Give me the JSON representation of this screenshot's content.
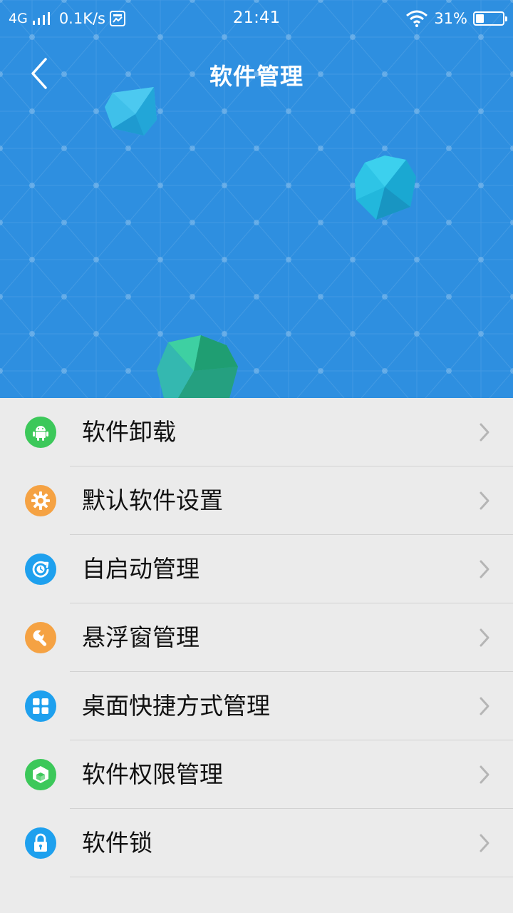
{
  "status_bar": {
    "network": "4G",
    "speed": "0.1K/s",
    "time": "21:41",
    "battery": "31%",
    "battery_level": 0.31
  },
  "header": {
    "title": "软件管理",
    "background_color": "#2e8fe0"
  },
  "menu": {
    "items": [
      {
        "label": "软件卸载",
        "icon": "android-icon",
        "color": "#3cc85a"
      },
      {
        "label": "默认软件设置",
        "icon": "gear-icon",
        "color": "#f5a243"
      },
      {
        "label": "自启动管理",
        "icon": "startup-icon",
        "color": "#1ea0ee"
      },
      {
        "label": "悬浮窗管理",
        "icon": "wrench-icon",
        "color": "#f5a243"
      },
      {
        "label": "桌面快捷方式管理",
        "icon": "grid-icon",
        "color": "#1ea0ee"
      },
      {
        "label": "软件权限管理",
        "icon": "cube-icon",
        "color": "#3cc85a"
      },
      {
        "label": "软件锁",
        "icon": "lock-icon",
        "color": "#1ea0ee"
      }
    ]
  }
}
